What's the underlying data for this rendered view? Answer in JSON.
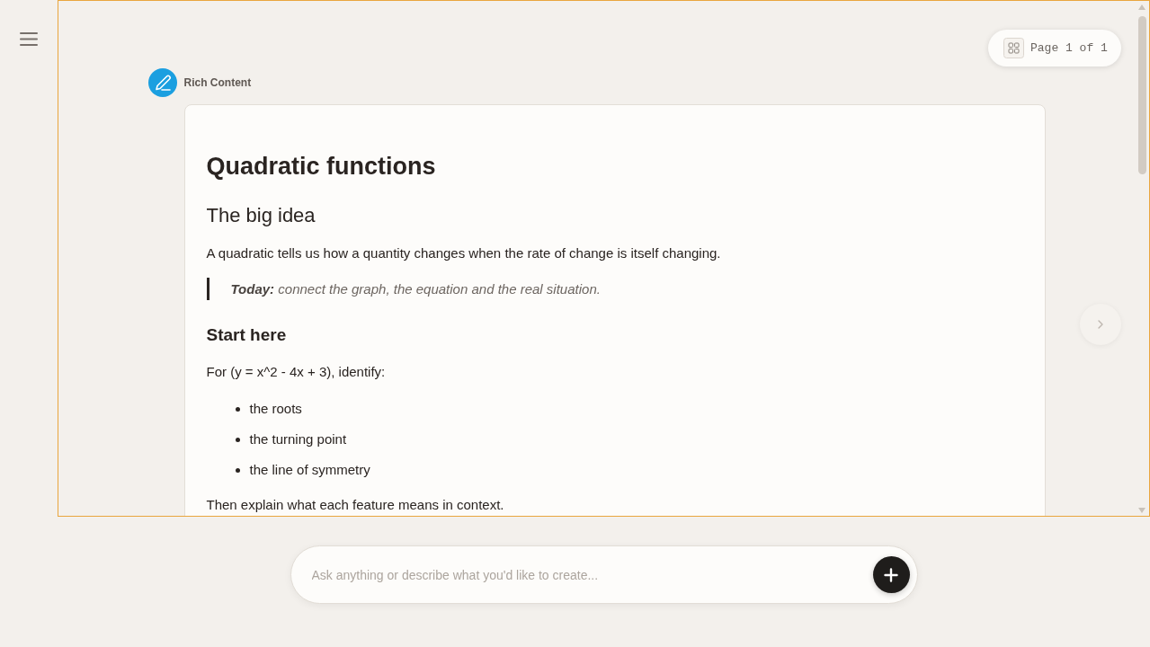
{
  "page_indicator": {
    "label": "Page 1 of 1"
  },
  "next_button": {
    "disabled": true
  },
  "content": {
    "source_label": "Rich Content",
    "blocks": [
      {
        "kind": "h1",
        "text": "Quadratic functions"
      },
      {
        "kind": "h2",
        "text": "The big idea"
      },
      {
        "kind": "paragraph",
        "text": "A quadratic tells us how a quantity changes when the rate of change is itself changing."
      },
      {
        "kind": "quote",
        "text": "**Today:** connect the graph, the equation and the real situation."
      },
      {
        "kind": "h3",
        "text": "Start here"
      },
      {
        "kind": "paragraph",
        "text": "For (y = x^2 - 4x + 3), identify:"
      },
      {
        "kind": "list",
        "items": [
          "the roots",
          "the turning point",
          "the line of symmetry"
        ]
      },
      {
        "kind": "paragraph",
        "text": "Then explain what each feature means in context."
      }
    ]
  },
  "composer": {
    "placeholder": "Ask anything or describe what you'd like to create..."
  }
}
